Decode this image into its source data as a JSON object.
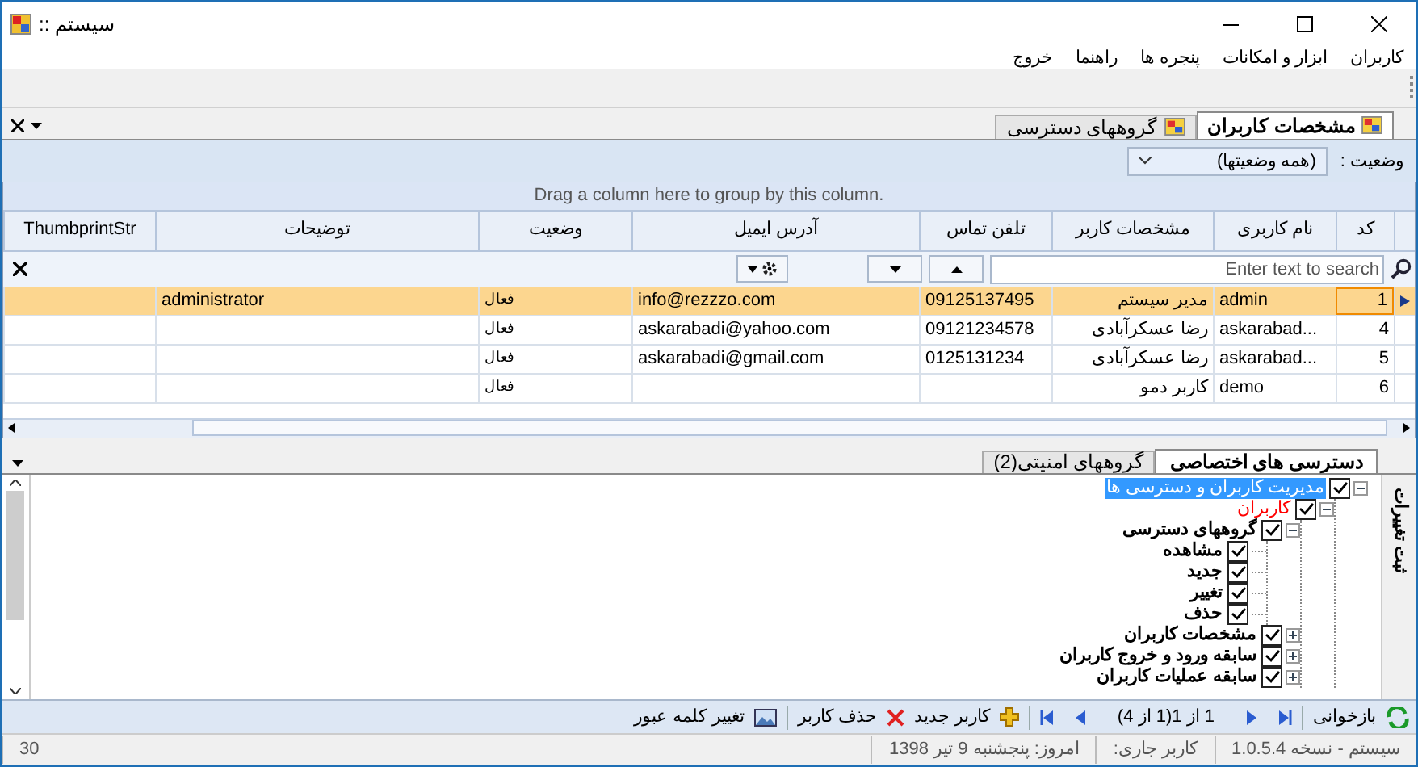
{
  "window": {
    "title": ":: سیستم"
  },
  "menu": [
    "کاربران",
    "ابزار و امکانات",
    "پنجره ها",
    "راهنما",
    "خروج"
  ],
  "doc_tabs": [
    {
      "label": "مشخصات کاربران",
      "selected": true
    },
    {
      "label": "گروههای دسترسی",
      "selected": false
    }
  ],
  "filter": {
    "label": "وضعیت :",
    "value": "(همه وضعیتها)"
  },
  "grid": {
    "group_hint": "Drag a column here to group by this column.",
    "columns": [
      "کد",
      "نام کاربری",
      "مشخصات کاربر",
      "تلفن تماس",
      "آدرس ایمیل",
      "وضعیت",
      "توضیحات",
      "ThumbprintStr"
    ],
    "search": {
      "placeholder": "Enter text to search"
    },
    "rows": [
      {
        "cells": [
          "1",
          "admin",
          "مدیر سیستم",
          "09125137495",
          "info@rezzzo.com",
          "فعال",
          "administrator",
          ""
        ],
        "selected": true
      },
      {
        "cells": [
          "4",
          "askarabad...",
          "رضا عسکرآبادی",
          "09121234578",
          "askarabadi@yahoo.com",
          "فعال",
          "",
          ""
        ],
        "selected": false
      },
      {
        "cells": [
          "5",
          "askarabad...",
          "رضا عسکرآبادی",
          "0125131234",
          "askarabadi@gmail.com",
          "فعال",
          "",
          ""
        ],
        "selected": false
      },
      {
        "cells": [
          "6",
          "demo",
          "کاربر دمو",
          "",
          "",
          "فعال",
          "",
          ""
        ],
        "selected": false
      }
    ]
  },
  "lower_tabs": [
    {
      "label": "دسترسی های اختصاصی",
      "selected": true
    },
    {
      "label": "گروههای امنیتی(2)",
      "selected": false
    }
  ],
  "side_tab": "ثبت تغییرات",
  "tree": [
    {
      "label": "مدیریت کاربران و دسترسی ها",
      "checked": true,
      "expanded": true,
      "selected": true,
      "children": [
        {
          "label": "کاربران",
          "checked": true,
          "expanded": true,
          "selected": false,
          "color": "#ff0000",
          "children": [
            {
              "label": "گروههای دسترسی",
              "checked": true,
              "expanded": true,
              "selected": false,
              "color": "#000000",
              "children": [
                {
                  "label": "مشاهده",
                  "checked": true,
                  "selected": false,
                  "color": "#000000"
                },
                {
                  "label": "جدید",
                  "checked": true,
                  "selected": false,
                  "color": "#000000"
                },
                {
                  "label": "تغییر",
                  "checked": true,
                  "selected": false,
                  "color": "#000000"
                },
                {
                  "label": "حذف",
                  "checked": true,
                  "selected": false,
                  "color": "#000000"
                }
              ]
            },
            {
              "label": "مشخصات کاربران",
              "checked": true,
              "expanded": false,
              "selected": false,
              "color": "#000000"
            },
            {
              "label": "سابقه ورود و خروج کاربران",
              "checked": true,
              "expanded": false,
              "selected": false,
              "color": "#000000"
            },
            {
              "label": "سابقه عملیات کاربران",
              "checked": true,
              "expanded": false,
              "selected": false,
              "color": "#000000"
            }
          ]
        }
      ]
    }
  ],
  "toolbar": {
    "refresh": "بازخوانی",
    "pager": "1 از 1(1 از 4)",
    "new_user": "کاربر جدید",
    "delete_user": "حذف کاربر",
    "change_password": "تغییر کلمه عبور"
  },
  "status_bar": [
    "سیستم - نسخه 1.0.5.4",
    "کاربر جاری:",
    "امروز: پنجشنبه 9 تیر 1398",
    "30"
  ]
}
